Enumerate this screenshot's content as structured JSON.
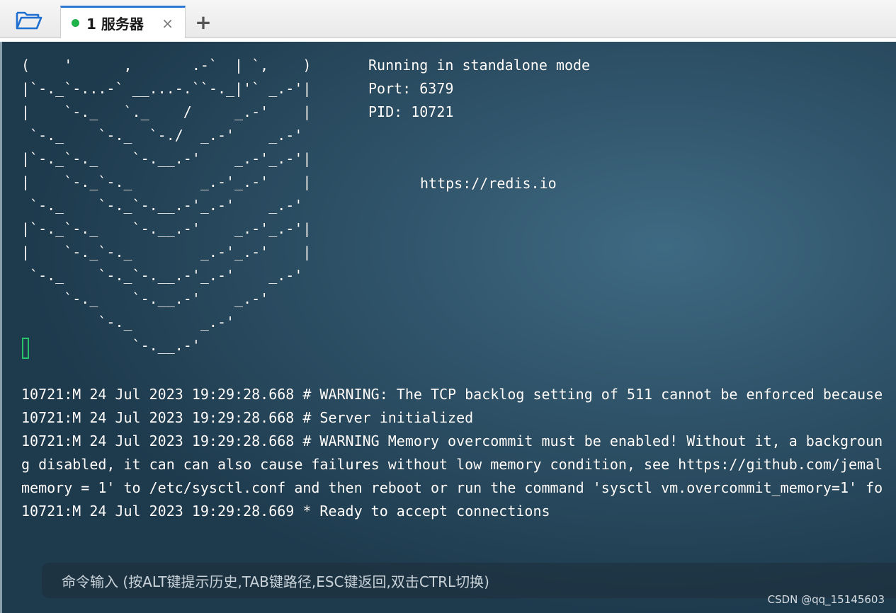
{
  "tabs": [
    {
      "label": "1 服务器",
      "status_color": "#21b24b",
      "active": true
    }
  ],
  "icons": {
    "open": "folder-open-icon",
    "close": "close-icon",
    "add": "plus-icon"
  },
  "toolbar": {
    "close_glyph": "×",
    "add_glyph": "+"
  },
  "terminal": {
    "ascii_art": [
      "(    '      ,       .-`  | `,    )",
      "|`-._`-...-` __...-.``-._|'` _.-'|",
      "|    `-._   `._    /     _.-'    |",
      " `-._    `-._  `-./  _.-'    _.-'",
      "|`-._`-._    `-.__.-'    _.-'_.-'|",
      "|    `-._`-._        _.-'_.-'    |",
      " `-._    `-._`-.__.-'_.-'    _.-'",
      "|`-._`-._    `-.__.-'    _.-'_.-'|",
      "|    `-._`-._        _.-'_.-'    |",
      " `-._    `-._`-.__.-'_.-'    _.-'",
      "     `-._    `-.__.-'    _.-'",
      "         `-._        _.-'",
      "             `-.__.-'"
    ],
    "info": {
      "mode": "Running in standalone mode",
      "port": "Port: 6379",
      "pid": "PID: 10721",
      "url": "https://redis.io"
    },
    "log_lines": [
      "10721:M 24 Jul 2023 19:29:28.668 # WARNING: The TCP backlog setting of 511 cannot be enforced because",
      "10721:M 24 Jul 2023 19:29:28.668 # Server initialized",
      "10721:M 24 Jul 2023 19:29:28.668 # WARNING Memory overcommit must be enabled! Without it, a backgroun",
      "g disabled, it can can also cause failures without low memory condition, see https://github.com/jemal",
      "memory = 1' to /etc/sysctl.conf and then reboot or run the command 'sysctl vm.overcommit_memory=1' fo",
      "10721:M 24 Jul 2023 19:29:28.669 * Ready to accept connections"
    ],
    "cursor_color": "#27c36a"
  },
  "command_input": {
    "placeholder": "命令输入 (按ALT键提示历史,TAB键路径,ESC键返回,双击CTRL切换)"
  },
  "watermark": "CSDN @qq_15145603"
}
